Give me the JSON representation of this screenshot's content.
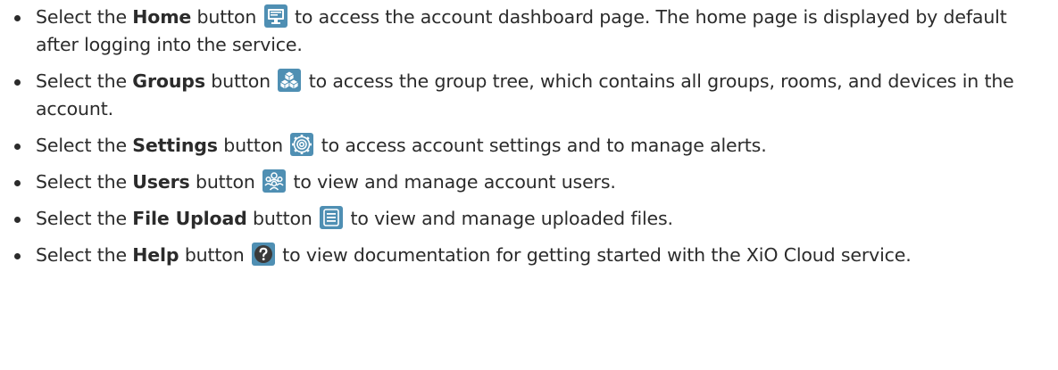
{
  "colors": {
    "icon_bg": "#4f8fb3",
    "text": "#2b2b2b",
    "help_bg": "#3a3a3a"
  },
  "items": [
    {
      "prefix": "Select the ",
      "bold": "Home",
      "mid": " button",
      "icon": "monitor-icon",
      "suffix": " to access the account dashboard page. The home page is displayed by default after logging into the service."
    },
    {
      "prefix": "Select the ",
      "bold": "Groups",
      "mid": " button",
      "icon": "cubes-icon",
      "suffix": " to access the group tree, which contains all groups, rooms, and devices in the account."
    },
    {
      "prefix": "Select the ",
      "bold": "Settings",
      "mid": " button",
      "icon": "gear-icon",
      "suffix": " to access account settings and to manage alerts."
    },
    {
      "prefix": "Select the ",
      "bold": "Users",
      "mid": " button",
      "icon": "users-icon",
      "suffix": " to view and manage account users."
    },
    {
      "prefix": "Select the ",
      "bold": "File Upload",
      "mid": " button",
      "icon": "file-list-icon",
      "suffix": " to view and manage uploaded files."
    },
    {
      "prefix": "Select the ",
      "bold": "Help",
      "mid": " button",
      "icon": "question-circle-icon",
      "suffix": " to view documentation for getting started with the XiO Cloud service."
    }
  ]
}
